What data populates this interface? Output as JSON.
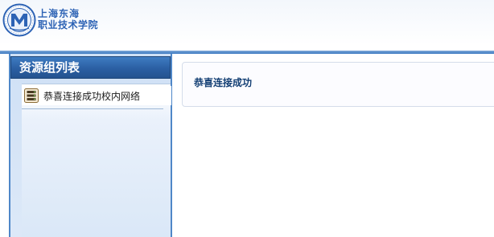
{
  "header": {
    "school_name_line1": "上海东海",
    "school_name_line2": "职业技术学院",
    "logo_icon": "school-seal-icon",
    "logo_letter": "M"
  },
  "sidebar": {
    "title": "资源组列表",
    "items": [
      {
        "label": "恭喜连接成功校内网络",
        "icon": "server-rack-icon"
      }
    ]
  },
  "main": {
    "message": "恭喜连接成功"
  },
  "colors": {
    "accent": "#2b5fa3",
    "logo_blue": "#2d63b5",
    "message_text": "#123e73",
    "sidebar_bg": "#d9e7f7"
  }
}
